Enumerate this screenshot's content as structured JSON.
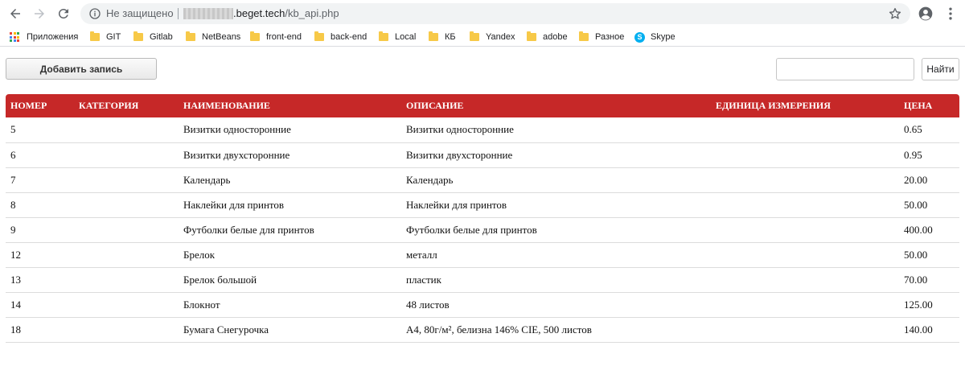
{
  "browser": {
    "security_label": "Не защищено",
    "url_host": ".beget.tech",
    "url_path": "/kb_api.php"
  },
  "bookmarks": [
    {
      "label": "Приложения",
      "type": "apps"
    },
    {
      "label": "GIT",
      "type": "folder"
    },
    {
      "label": "Gitlab",
      "type": "folder"
    },
    {
      "label": "NetBeans",
      "type": "folder"
    },
    {
      "label": "front-end",
      "type": "folder"
    },
    {
      "label": "back-end",
      "type": "folder"
    },
    {
      "label": "Local",
      "type": "folder"
    },
    {
      "label": "КБ",
      "type": "folder"
    },
    {
      "label": "Yandex",
      "type": "folder"
    },
    {
      "label": "adobe",
      "type": "folder"
    },
    {
      "label": "Разное",
      "type": "folder"
    },
    {
      "label": "Skype",
      "type": "skype"
    }
  ],
  "toolbar": {
    "add_label": "Добавить запись",
    "search_value": "",
    "find_label": "Найти"
  },
  "table": {
    "headers": [
      "НОМЕР",
      "КАТЕГОРИЯ",
      "НАИМЕНОВАНИЕ",
      "ОПИСАНИЕ",
      "ЕДИНИЦА ИЗМЕРЕНИЯ",
      "ЦЕНА"
    ],
    "rows": [
      [
        "5",
        "",
        "Визитки односторонние",
        "Визитки односторонние",
        "",
        "0.65"
      ],
      [
        "6",
        "",
        "Визитки двухсторонние",
        "Визитки двухсторонние",
        "",
        "0.95"
      ],
      [
        "7",
        "",
        "Календарь",
        "Календарь",
        "",
        "20.00"
      ],
      [
        "8",
        "",
        "Наклейки для принтов",
        "Наклейки для принтов",
        "",
        "50.00"
      ],
      [
        "9",
        "",
        "Футболки белые для принтов",
        "Футболки белые для принтов",
        "",
        "400.00"
      ],
      [
        "12",
        "",
        "Брелок",
        "металл",
        "",
        "50.00"
      ],
      [
        "13",
        "",
        "Брелок большой",
        "пластик",
        "",
        "70.00"
      ],
      [
        "14",
        "",
        "Блокнот",
        "48 листов",
        "",
        "125.00"
      ],
      [
        "18",
        "",
        "Бумага Снегурочка",
        "А4, 80г/м², белизна 146% CIE, 500 листов",
        "",
        "140.00"
      ]
    ]
  },
  "colors": {
    "header_bg": "#c62828",
    "header_text": "#ffffff",
    "bookmark_folder": "#f7c948"
  }
}
